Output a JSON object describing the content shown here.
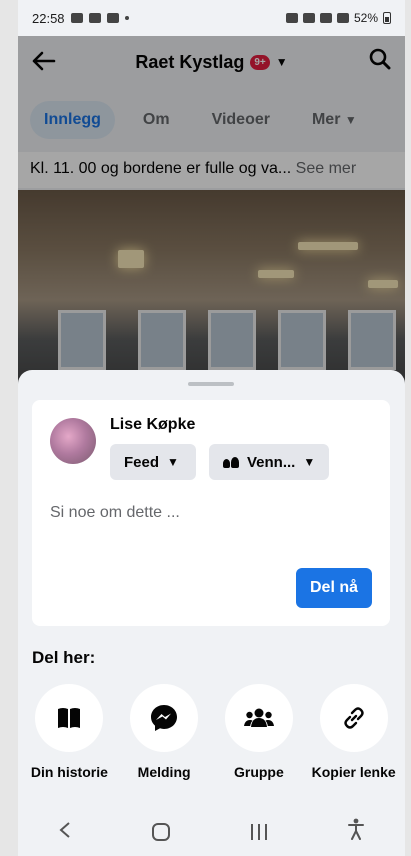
{
  "status_bar": {
    "time": "22:58",
    "battery": "52%"
  },
  "header": {
    "title": "Raet Kystlag",
    "badge": "9+"
  },
  "tabs": [
    {
      "label": "Innlegg",
      "active": true
    },
    {
      "label": "Om"
    },
    {
      "label": "Videoer"
    },
    {
      "label": "Mer"
    }
  ],
  "post": {
    "text": "Kl. 11. 00 og bordene er fulle og va...",
    "see_more": "See mer"
  },
  "share_sheet": {
    "user_name": "Lise Køpke",
    "feed_label": "Feed",
    "audience_label": "Venn...",
    "placeholder": "Si noe om dette ...",
    "share_button": "Del nå",
    "share_here": "Del her:",
    "targets": [
      {
        "label": "Din historie",
        "icon": "book-icon"
      },
      {
        "label": "Melding",
        "icon": "messenger-icon"
      },
      {
        "label": "Gruppe",
        "icon": "group-icon"
      },
      {
        "label": "Kopier lenke",
        "icon": "link-icon"
      }
    ]
  },
  "colors": {
    "accent": "#1b74e4",
    "badge": "#e41e3f"
  }
}
